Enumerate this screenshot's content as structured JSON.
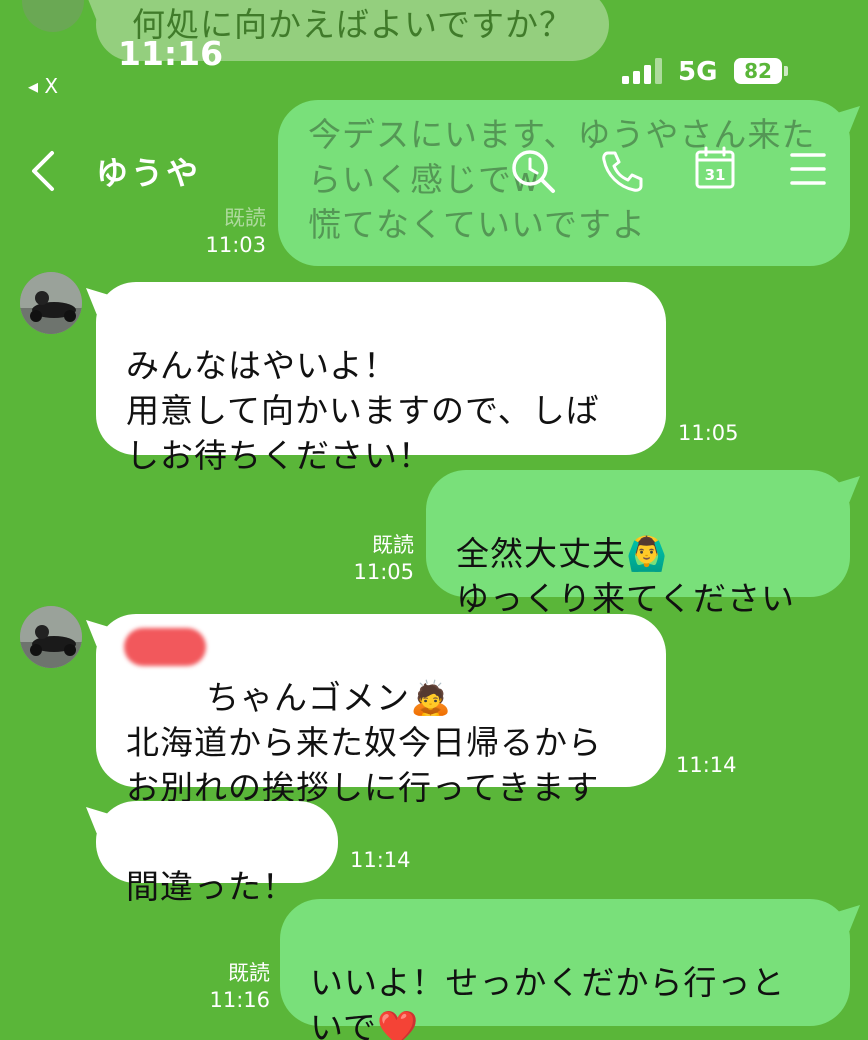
{
  "status_bar": {
    "time": "11:16",
    "back_label": "◂ X",
    "network": "5G",
    "battery": "82"
  },
  "header": {
    "title": "ゆうや"
  },
  "messages": [
    {
      "text": "何処に向かえばよいですか？",
      "time": ""
    },
    {
      "text": "今デスにいます、ゆうやさん来たらいく感じでw\n慌てなくていいですよ",
      "read": "既読",
      "time": "11:03"
    },
    {
      "text": "みんなはやいよ！\n用意して向かいますので、しば\nしお待ちください！",
      "time": "11:05"
    },
    {
      "text": "全然大丈夫🙆‍♂️\nゆっくり来てください",
      "read": "既読",
      "time": "11:05"
    },
    {
      "text": "ちゃんゴメン🙇\n北海道から来た奴今日帰るから\nお別れの挨拶しに行ってきます",
      "time": "11:14"
    },
    {
      "text": "間違った！",
      "time": "11:14"
    },
    {
      "text": "いいよ！せっかくだから行っと\nいで❤️",
      "read": "既読",
      "time": "11:16"
    }
  ]
}
